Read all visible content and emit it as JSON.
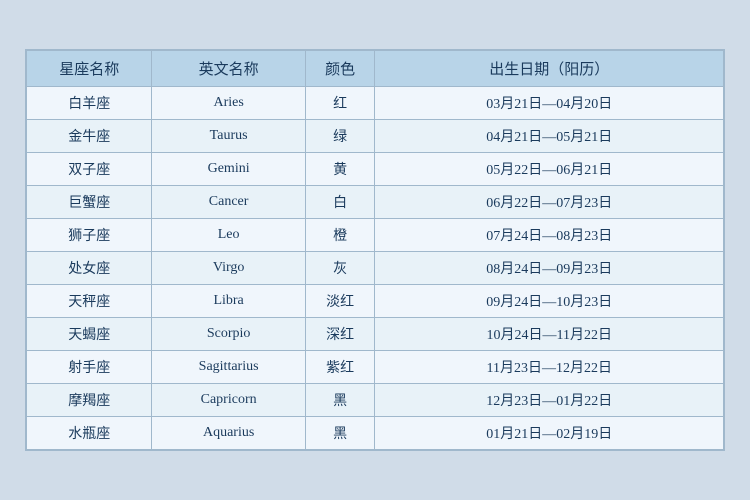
{
  "table": {
    "headers": {
      "chinese_name": "星座名称",
      "english_name": "英文名称",
      "color": "颜色",
      "birthdate": "出生日期（阳历）"
    },
    "rows": [
      {
        "chinese": "白羊座",
        "english": "Aries",
        "color": "红",
        "date": "03月21日—04月20日"
      },
      {
        "chinese": "金牛座",
        "english": "Taurus",
        "color": "绿",
        "date": "04月21日—05月21日"
      },
      {
        "chinese": "双子座",
        "english": "Gemini",
        "color": "黄",
        "date": "05月22日—06月21日"
      },
      {
        "chinese": "巨蟹座",
        "english": "Cancer",
        "color": "白",
        "date": "06月22日—07月23日"
      },
      {
        "chinese": "狮子座",
        "english": "Leo",
        "color": "橙",
        "date": "07月24日—08月23日"
      },
      {
        "chinese": "处女座",
        "english": "Virgo",
        "color": "灰",
        "date": "08月24日—09月23日"
      },
      {
        "chinese": "天秤座",
        "english": "Libra",
        "color": "淡红",
        "date": "09月24日—10月23日"
      },
      {
        "chinese": "天蝎座",
        "english": "Scorpio",
        "color": "深红",
        "date": "10月24日—11月22日"
      },
      {
        "chinese": "射手座",
        "english": "Sagittarius",
        "color": "紫红",
        "date": "11月23日—12月22日"
      },
      {
        "chinese": "摩羯座",
        "english": "Capricorn",
        "color": "黑",
        "date": "12月23日—01月22日"
      },
      {
        "chinese": "水瓶座",
        "english": "Aquarius",
        "color": "黑",
        "date": "01月21日—02月19日"
      }
    ]
  }
}
